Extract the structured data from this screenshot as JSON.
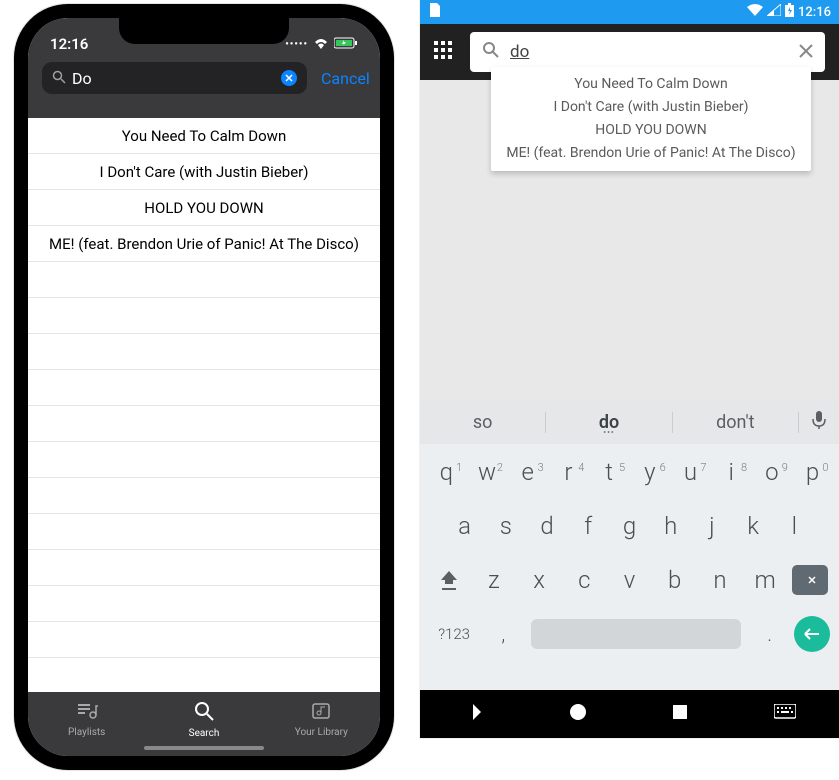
{
  "ios": {
    "status_time": "12:16",
    "search_value": "Do",
    "cancel_label": "Cancel",
    "results": [
      "You Need To Calm Down",
      "I Don't Care (with Justin Bieber)",
      "HOLD YOU DOWN",
      "ME! (feat. Brendon Urie of Panic! At The Disco)"
    ],
    "tabs": {
      "playlists": "Playlists",
      "search": "Search",
      "library": "Your Library"
    }
  },
  "android": {
    "status_time": "12:16",
    "search_value": "do",
    "results": [
      "You Need To Calm Down",
      "I Don't Care (with Justin Bieber)",
      "HOLD YOU DOWN",
      "ME! (feat. Brendon Urie of Panic! At The Disco)"
    ],
    "keyboard": {
      "suggestions": {
        "left": "so",
        "center": "do",
        "right": "don't"
      },
      "row1_nums": [
        "1",
        "2",
        "3",
        "4",
        "5",
        "6",
        "7",
        "8",
        "9",
        "0"
      ],
      "row1": [
        "q",
        "w",
        "e",
        "r",
        "t",
        "y",
        "u",
        "i",
        "o",
        "p"
      ],
      "row2": [
        "a",
        "s",
        "d",
        "f",
        "g",
        "h",
        "j",
        "k",
        "l"
      ],
      "row3": [
        "z",
        "x",
        "c",
        "v",
        "b",
        "n",
        "m"
      ],
      "switch": "?123",
      "comma": ",",
      "period": "."
    }
  }
}
